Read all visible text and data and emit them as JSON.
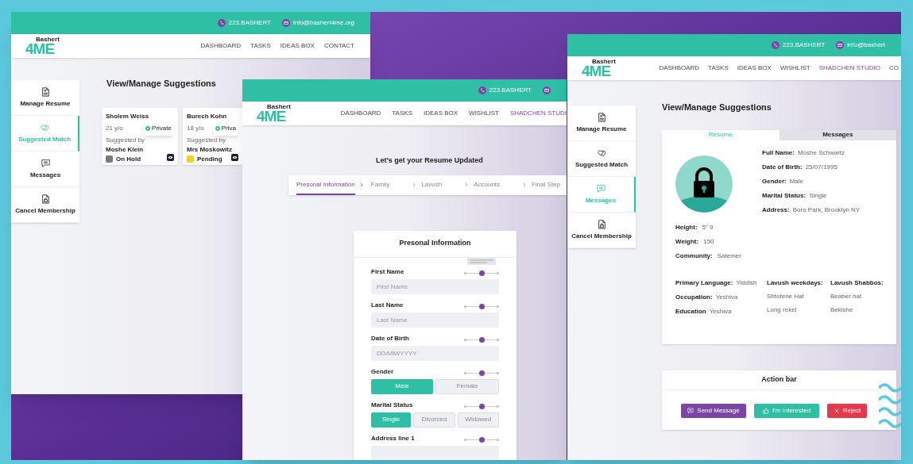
{
  "windows": [
    {
      "kind": "suggestions",
      "phone": "223.BASHERT",
      "email": "info@bashert4me.org",
      "logo": {
        "top": "Bashert",
        "main": "4ME"
      },
      "nav": [
        {
          "label": "DASHBOARD",
          "selected": false
        },
        {
          "label": "TASKS",
          "selected": false
        },
        {
          "label": "IDEAS BOX",
          "selected": false
        },
        {
          "label": "CONTACT",
          "selected": false
        }
      ],
      "sidebar": [
        {
          "label": "Manage Resume",
          "selected": false
        },
        {
          "label": "Suggested Match",
          "selected": true
        },
        {
          "label": "Messages",
          "selected": false
        },
        {
          "label": "Cancel Membership",
          "selected": false
        }
      ],
      "title": "View/Manage Suggestions",
      "cards": [
        {
          "name": "Sholem Weiss",
          "age": "21 y/o",
          "suggested_label": "Suggested by",
          "suggested_by": "Moshe Klein",
          "privacy": "Private",
          "status": "On Hold",
          "color": "#7a7a7a"
        },
        {
          "name": "Burech Kohn",
          "age": "18 y/o",
          "suggested_label": "Suggested by",
          "suggested_by": "Mrs Moskowitz",
          "privacy": "Priva",
          "status": "Pending",
          "color": "#f2d21b"
        }
      ]
    },
    {
      "kind": "resume",
      "phone": "223.BASHERT",
      "logo": {
        "top": "Bashert",
        "main": "4ME"
      },
      "nav": [
        {
          "label": "DASHBOARD",
          "selected": false
        },
        {
          "label": "TASKS",
          "selected": false
        },
        {
          "label": "IDEAS BOX",
          "selected": false
        },
        {
          "label": "WISHLIST",
          "selected": false
        },
        {
          "label": "SHADCHEN STUDI",
          "selected": true
        }
      ],
      "heading": "Let’s get your Resume Updated",
      "steps": [
        {
          "label": "Presonal Information",
          "selected": true
        },
        {
          "label": "Family",
          "selected": false
        },
        {
          "label": "Lavush",
          "selected": false
        },
        {
          "label": "Accounts",
          "selected": false
        },
        {
          "label": "Final Step",
          "selected": false
        }
      ],
      "form_title": "Presonal Information",
      "fields": [
        {
          "kind": "input",
          "label": "First Name",
          "placeholder": "First Name",
          "level": 0.5
        },
        {
          "kind": "input",
          "label": "Last Name",
          "placeholder": "Last Name",
          "level": 0.5
        },
        {
          "kind": "input",
          "label": "Date of Birth",
          "placeholder": "DD/MM/YYYY",
          "level": 0.5
        },
        {
          "kind": "choice",
          "label": "Gender",
          "level": 0.5,
          "options": [
            {
              "label": "Male",
              "selected": true
            },
            {
              "label": "Female",
              "selected": false
            }
          ]
        },
        {
          "kind": "choice",
          "label": "Marital Status",
          "level": 0.5,
          "options": [
            {
              "label": "Single",
              "selected": true
            },
            {
              "label": "Divorced",
              "selected": false
            },
            {
              "label": "Widowed",
              "selected": false
            }
          ]
        },
        {
          "kind": "input",
          "label": "Address line 1",
          "level": 0.5
        }
      ]
    },
    {
      "kind": "profile",
      "phone": "223.BASHERT",
      "email": "info@bashert",
      "logo": {
        "top": "Bashert",
        "main": "4ME"
      },
      "nav": [
        {
          "label": "DASHBOARD",
          "selected": false
        },
        {
          "label": "TASKS",
          "selected": false
        },
        {
          "label": "IDEAS BOX",
          "selected": false
        },
        {
          "label": "WISHLIST",
          "selected": false
        },
        {
          "label": "SHADCHEN STUDIO",
          "selected": true
        },
        {
          "label": "CO",
          "selected": false
        }
      ],
      "sidebar": [
        {
          "label": "Manage Resume",
          "selected": false
        },
        {
          "label": "Suggested Match",
          "selected": false
        },
        {
          "label": "Messages",
          "selected": true
        },
        {
          "label": "Cancel Membership",
          "selected": false
        }
      ],
      "title": "View/Manage Suggestions",
      "tabs": [
        {
          "label": "Resume",
          "selected": true
        },
        {
          "label": "Messages",
          "selected": false
        }
      ],
      "details": [
        {
          "label": "Full Name:",
          "value": "Moshe Schwartz"
        },
        {
          "label": "Date of Birth:",
          "value": "25/07/1995"
        },
        {
          "label": "Gender:",
          "value": "Male"
        },
        {
          "label": "Marital Status:",
          "value": "Single"
        },
        {
          "label": "Address:",
          "value": "Boro Park, Brooklyn NY"
        }
      ],
      "body": [
        {
          "label": "Height:",
          "value": "5\" 9"
        },
        {
          "label": "Weight:",
          "value": "150"
        },
        {
          "label": "Community:",
          "value": "Satemer"
        }
      ],
      "languages": [
        {
          "label": "Primary Language:",
          "value": "Yiddish"
        },
        {
          "label": "Occupation:",
          "value": "Yeshiva"
        },
        {
          "label": "Education",
          "value": "Yeshiva"
        }
      ],
      "lavush": [
        {
          "title": "Lavush weekdays:",
          "items": [
            "Shtofene Hat",
            "Long rekel"
          ]
        },
        {
          "title": "Lavush Shabbos:",
          "items": [
            "Beaber hat",
            "Bekishe"
          ]
        }
      ],
      "action_title": "Action bar",
      "actions": [
        {
          "kind": "message",
          "label": "Send Message"
        },
        {
          "kind": "interest",
          "label": "I'm Interested"
        },
        {
          "kind": "reject",
          "label": "Reject"
        }
      ]
    }
  ]
}
